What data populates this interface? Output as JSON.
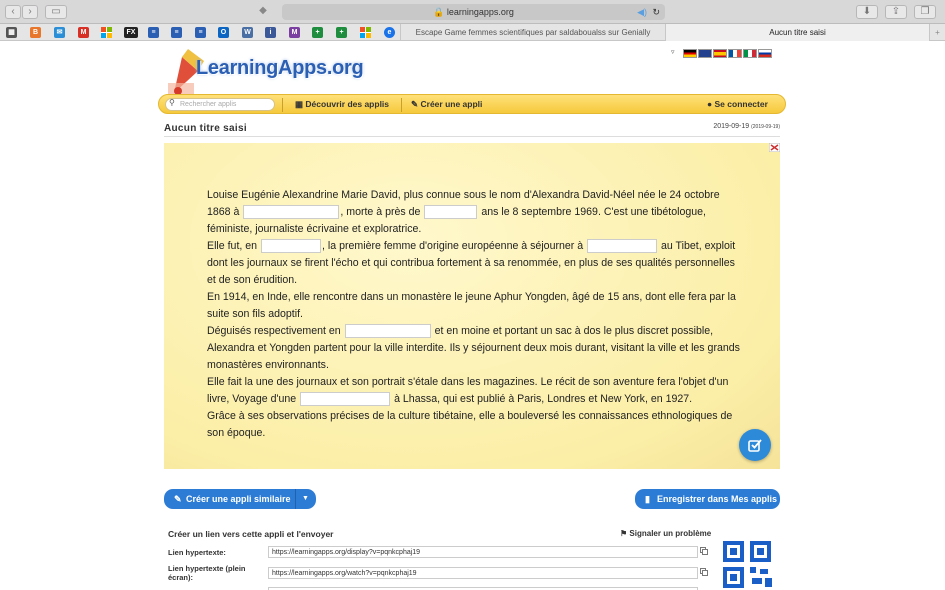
{
  "browser": {
    "url": "learningapps.org",
    "tabs": [
      {
        "label": "Escape Game femmes scientifiques par saldaboualss sur Genially"
      },
      {
        "label": "Aucun titre saisi"
      }
    ]
  },
  "site": {
    "logo_text": "LearningApps.org",
    "nav": {
      "search_placeholder": "Rechercher applis",
      "discover": "Découvrir des applis",
      "create": "Créer une appli",
      "login": "Se connecter"
    }
  },
  "app": {
    "title": "Aucun titre saisi",
    "date": "2019-09-19",
    "date_small": "(2019-09-19)",
    "text": [
      "Louise Eugénie Alexandrine Marie David, plus connue sous le nom d'Alexandra David-Néel née le 24 octobre 1868 à ",
      ", morte à près de ",
      " ans le 8 septembre 1969. C'est une tibétologue, féministe, journaliste écrivaine et exploratrice.",
      "Elle fut, en ",
      ", la première femme d'origine européenne à séjourner à ",
      " au Tibet, exploit dont les journaux se firent l'écho et qui contribua fortement à sa renommée, en plus de ses qualités personnelles et de son érudition.",
      "En 1914, en Inde, elle rencontre dans un monastère le jeune Aphur Yongden, âgé de 15 ans, dont elle fera par la suite son fils adoptif.",
      "Déguisés respectivement en ",
      " et en moine et portant un sac à dos le plus discret possible, Alexandra et Yongden partent pour la ville interdite. Ils y séjournent deux mois durant, visitant la ville et les grands monastères environnants.",
      "Elle fait la une des journaux et son portrait s'étale dans les magazines. Le récit de son aventure fera l'objet d'un livre, Voyage d'une ",
      " à Lhassa, qui est publié à Paris, Londres et New York, en 1927.",
      "Grâce à ses observations précises de la culture tibétaine, elle a bouleversé les connaissances ethnologiques de son époque."
    ]
  },
  "actions": {
    "similar": "Créer une appli similaire",
    "save": "Enregistrer dans Mes applis"
  },
  "share": {
    "heading": "Créer un lien vers cette appli et l'envoyer",
    "report": "Signaler un problème",
    "link_label": "Lien hypertexte:",
    "link_value": "https://learningapps.org/display?v=pqnkcphaj19",
    "full_label": "Lien hypertexte (plein écran):",
    "full_value": "https://learningapps.org/watch?v=pqnkcphaj19"
  }
}
